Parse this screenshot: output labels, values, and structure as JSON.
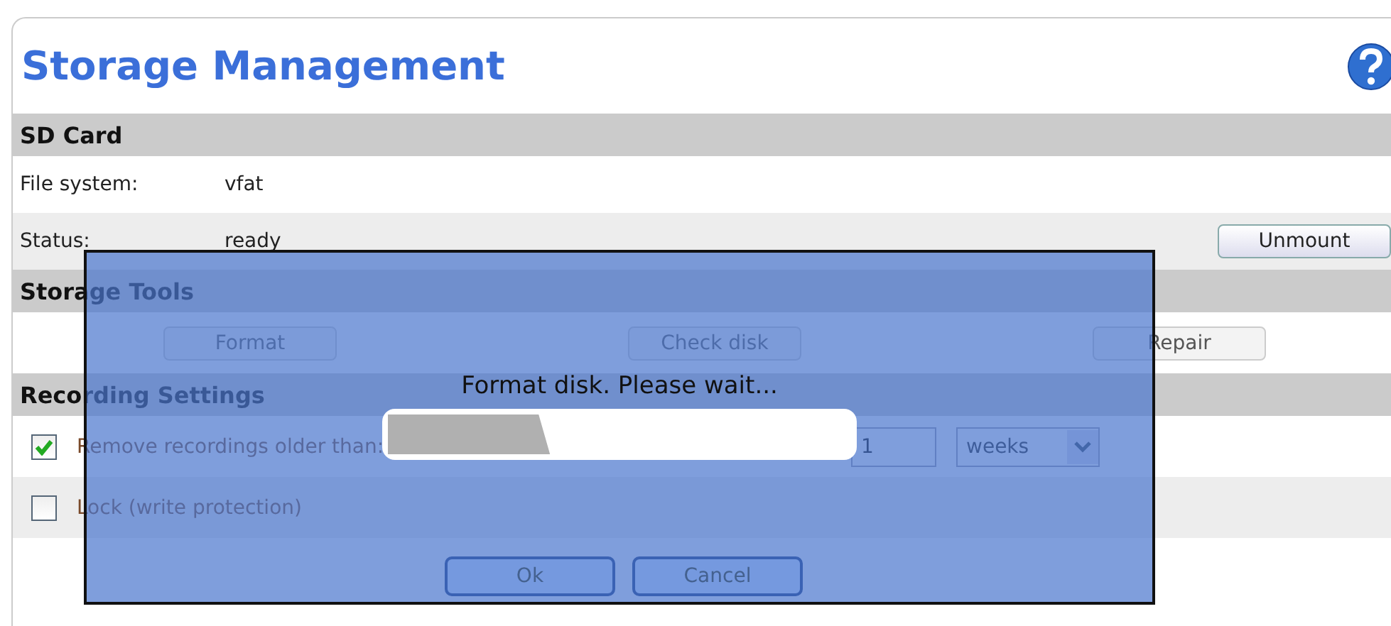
{
  "page": {
    "title": "Storage Management"
  },
  "sections": [
    {
      "title": "SD Card",
      "rows": [
        {
          "kind": "info",
          "label": "File system:",
          "value": "vfat"
        },
        {
          "kind": "info",
          "label": "Status:",
          "value": "ready",
          "button": "Unmount"
        }
      ]
    },
    {
      "title": "Storage Tools",
      "rows": [
        {
          "kind": "tools",
          "buttons": [
            {
              "label": "Format",
              "disabled": true
            },
            {
              "label": "Check disk",
              "disabled": true
            },
            {
              "label": "Repair",
              "disabled": true
            }
          ]
        }
      ]
    },
    {
      "title": "Recording Settings",
      "rows": [
        {
          "kind": "option",
          "checked": true,
          "label": "Remove recordings older than:",
          "input": "1",
          "select": "weeks"
        },
        {
          "kind": "option",
          "checked": false,
          "label": "Lock (write protection)"
        }
      ]
    }
  ],
  "dialog": {
    "message": "Format disk. Please wait...",
    "level": 0.35,
    "buttons": [
      "Ok",
      "Cancel"
    ]
  }
}
